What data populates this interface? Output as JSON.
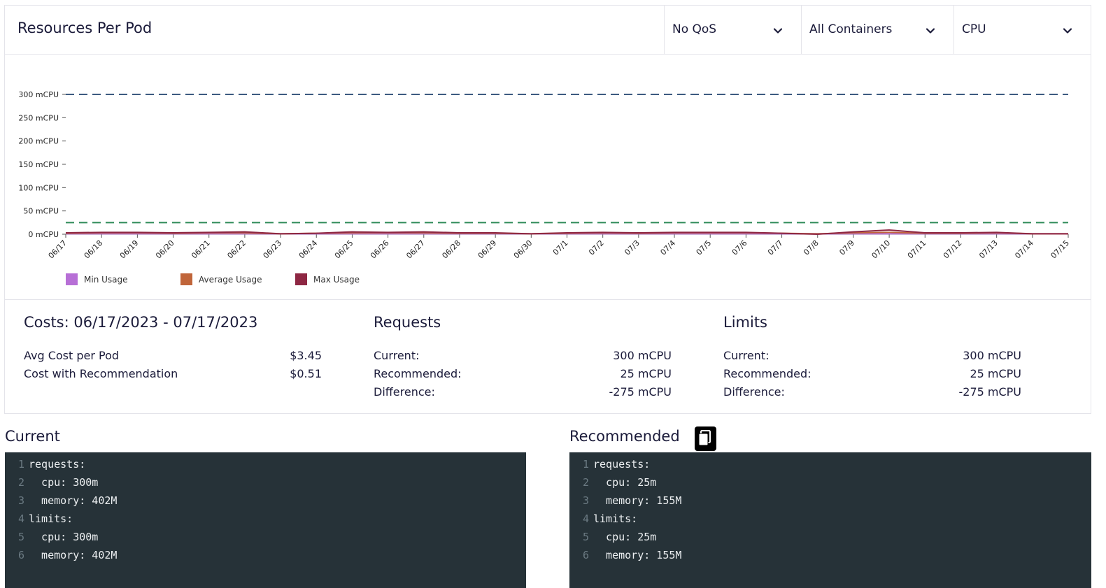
{
  "header": {
    "title": "Resources Per Pod",
    "qos_filter": "No QoS",
    "container_filter": "All Containers",
    "resource_filter": "CPU"
  },
  "chart_data": {
    "type": "line",
    "categories": [
      "06/17",
      "06/18",
      "06/19",
      "06/20",
      "06/21",
      "06/22",
      "06/23",
      "06/24",
      "06/25",
      "06/26",
      "06/27",
      "06/28",
      "06/29",
      "06/30",
      "07/1",
      "07/2",
      "07/3",
      "07/4",
      "07/5",
      "07/6",
      "07/7",
      "07/8",
      "07/9",
      "07/10",
      "07/11",
      "07/12",
      "07/13",
      "07/14",
      "07/15"
    ],
    "y_ticks": [
      "0 mCPU",
      "50 mCPU",
      "100 mCPU",
      "150 mCPU",
      "200 mCPU",
      "250 mCPU",
      "300 mCPU"
    ],
    "ylim": [
      0,
      300
    ],
    "series": [
      {
        "name": "Min Usage",
        "color": "#b76fd6",
        "values": [
          1,
          1,
          1,
          1,
          1,
          1,
          1,
          1,
          1,
          1,
          1,
          1,
          1,
          1,
          1,
          1,
          1,
          1,
          1,
          1,
          1,
          1,
          1,
          1,
          1,
          1,
          1,
          1,
          1
        ]
      },
      {
        "name": "Average Usage",
        "color": "#c0653a",
        "values": [
          2,
          3,
          3,
          2,
          3,
          3,
          1,
          2,
          3,
          3,
          3,
          2,
          2,
          1,
          2,
          3,
          2,
          3,
          3,
          3,
          2,
          1,
          3,
          4,
          2,
          2,
          3,
          1,
          1
        ]
      },
      {
        "name": "Max Usage",
        "color": "#8e2743",
        "values": [
          3,
          4,
          4,
          3,
          4,
          5,
          1,
          2,
          5,
          4,
          5,
          3,
          3,
          1,
          3,
          4,
          3,
          4,
          4,
          4,
          2,
          0,
          5,
          9,
          3,
          3,
          4,
          1,
          1
        ]
      }
    ],
    "reference_lines": [
      {
        "value": 300,
        "color": "#3d5a80"
      },
      {
        "value": 25,
        "color": "#2e8b57"
      }
    ],
    "grid": false,
    "legend": "bottom-left"
  },
  "costs": {
    "title": "Costs: 06/17/2023 - 07/17/2023",
    "rows": [
      {
        "label": "Avg Cost per Pod",
        "value": "$3.45"
      },
      {
        "label": "Cost with Recommendation",
        "value": "$0.51"
      }
    ]
  },
  "requests": {
    "title": "Requests",
    "rows": [
      {
        "label": "Current:",
        "value": "300 mCPU"
      },
      {
        "label": "Recommended:",
        "value": "25 mCPU"
      },
      {
        "label": "Difference:",
        "value": "-275 mCPU"
      }
    ]
  },
  "limits": {
    "title": "Limits",
    "rows": [
      {
        "label": "Current:",
        "value": "300 mCPU"
      },
      {
        "label": "Recommended:",
        "value": "25 mCPU"
      },
      {
        "label": "Difference:",
        "value": "-275 mCPU"
      }
    ]
  },
  "current_yaml": {
    "title": "Current",
    "lines": [
      {
        "n": "1",
        "text": "requests:"
      },
      {
        "n": "2",
        "text": "  cpu: 300m"
      },
      {
        "n": "3",
        "text": "  memory: 402M"
      },
      {
        "n": "4",
        "text": "limits:"
      },
      {
        "n": "5",
        "text": "  cpu: 300m"
      },
      {
        "n": "6",
        "text": "  memory: 402M"
      }
    ]
  },
  "recommended_yaml": {
    "title": "Recommended",
    "copy_icon": "copy-icon",
    "lines": [
      {
        "n": "1",
        "text": "requests:"
      },
      {
        "n": "2",
        "text": "  cpu: 25m"
      },
      {
        "n": "3",
        "text": "  memory: 155M"
      },
      {
        "n": "4",
        "text": "limits:"
      },
      {
        "n": "5",
        "text": "  cpu: 25m"
      },
      {
        "n": "6",
        "text": "  memory: 155M"
      }
    ]
  }
}
